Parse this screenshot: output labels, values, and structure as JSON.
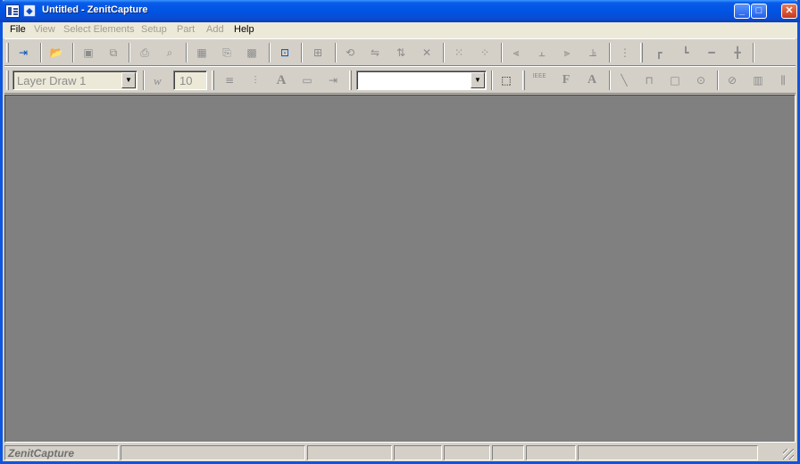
{
  "window": {
    "title": "Untitled - ZenitCapture",
    "minimize_glyph": "_",
    "maximize_glyph": "□",
    "close_glyph": "✕"
  },
  "menu": [
    {
      "label": "File",
      "enabled": true
    },
    {
      "label": "View",
      "enabled": false
    },
    {
      "label": "Select Elements",
      "enabled": false
    },
    {
      "label": "Setup",
      "enabled": false
    },
    {
      "label": "Part",
      "enabled": false
    },
    {
      "label": "Add",
      "enabled": false
    },
    {
      "label": "Help",
      "enabled": true
    }
  ],
  "toolbar2": {
    "layer_value": "Layer Draw 1",
    "width_label": "w",
    "width_value": "10",
    "text_a": "A",
    "text_f": "F",
    "text_a2": "A",
    "ieee_label": "IEEE"
  },
  "status": {
    "app_name": "ZenitCapture"
  }
}
